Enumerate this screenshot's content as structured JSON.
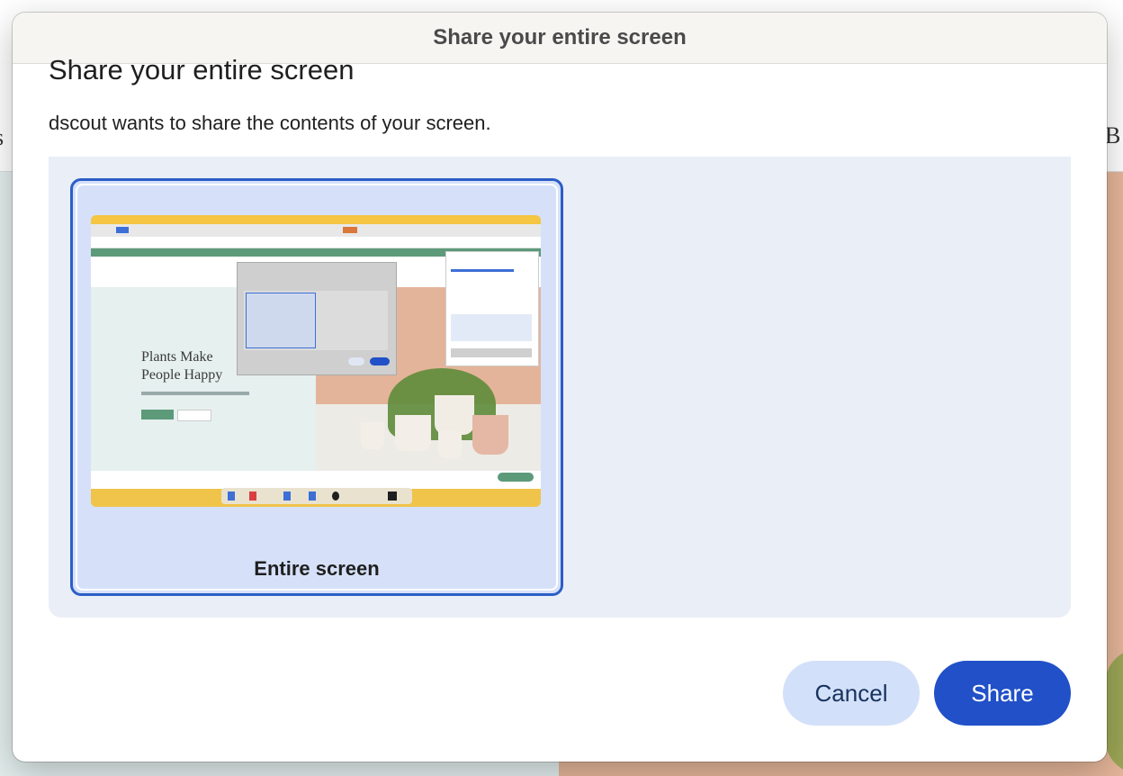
{
  "background": {
    "left_edge_text": "s",
    "right_edge_text": "B"
  },
  "dialog": {
    "window_title": "Share your entire screen",
    "heading": "Share your entire screen",
    "description": "dscout wants to share the contents of your screen.",
    "screen_option": {
      "label": "Entire screen",
      "selected": true,
      "thumbnail": {
        "hero_line1": "Plants Make",
        "hero_line2": "People Happy"
      }
    },
    "buttons": {
      "cancel": "Cancel",
      "share": "Share"
    }
  },
  "colors": {
    "accent": "#2150c8",
    "card_border": "#2b5ec7",
    "card_bg": "#d6e1f9",
    "picker_bg": "#eaeef6",
    "cancel_bg": "#d3e0f9"
  }
}
